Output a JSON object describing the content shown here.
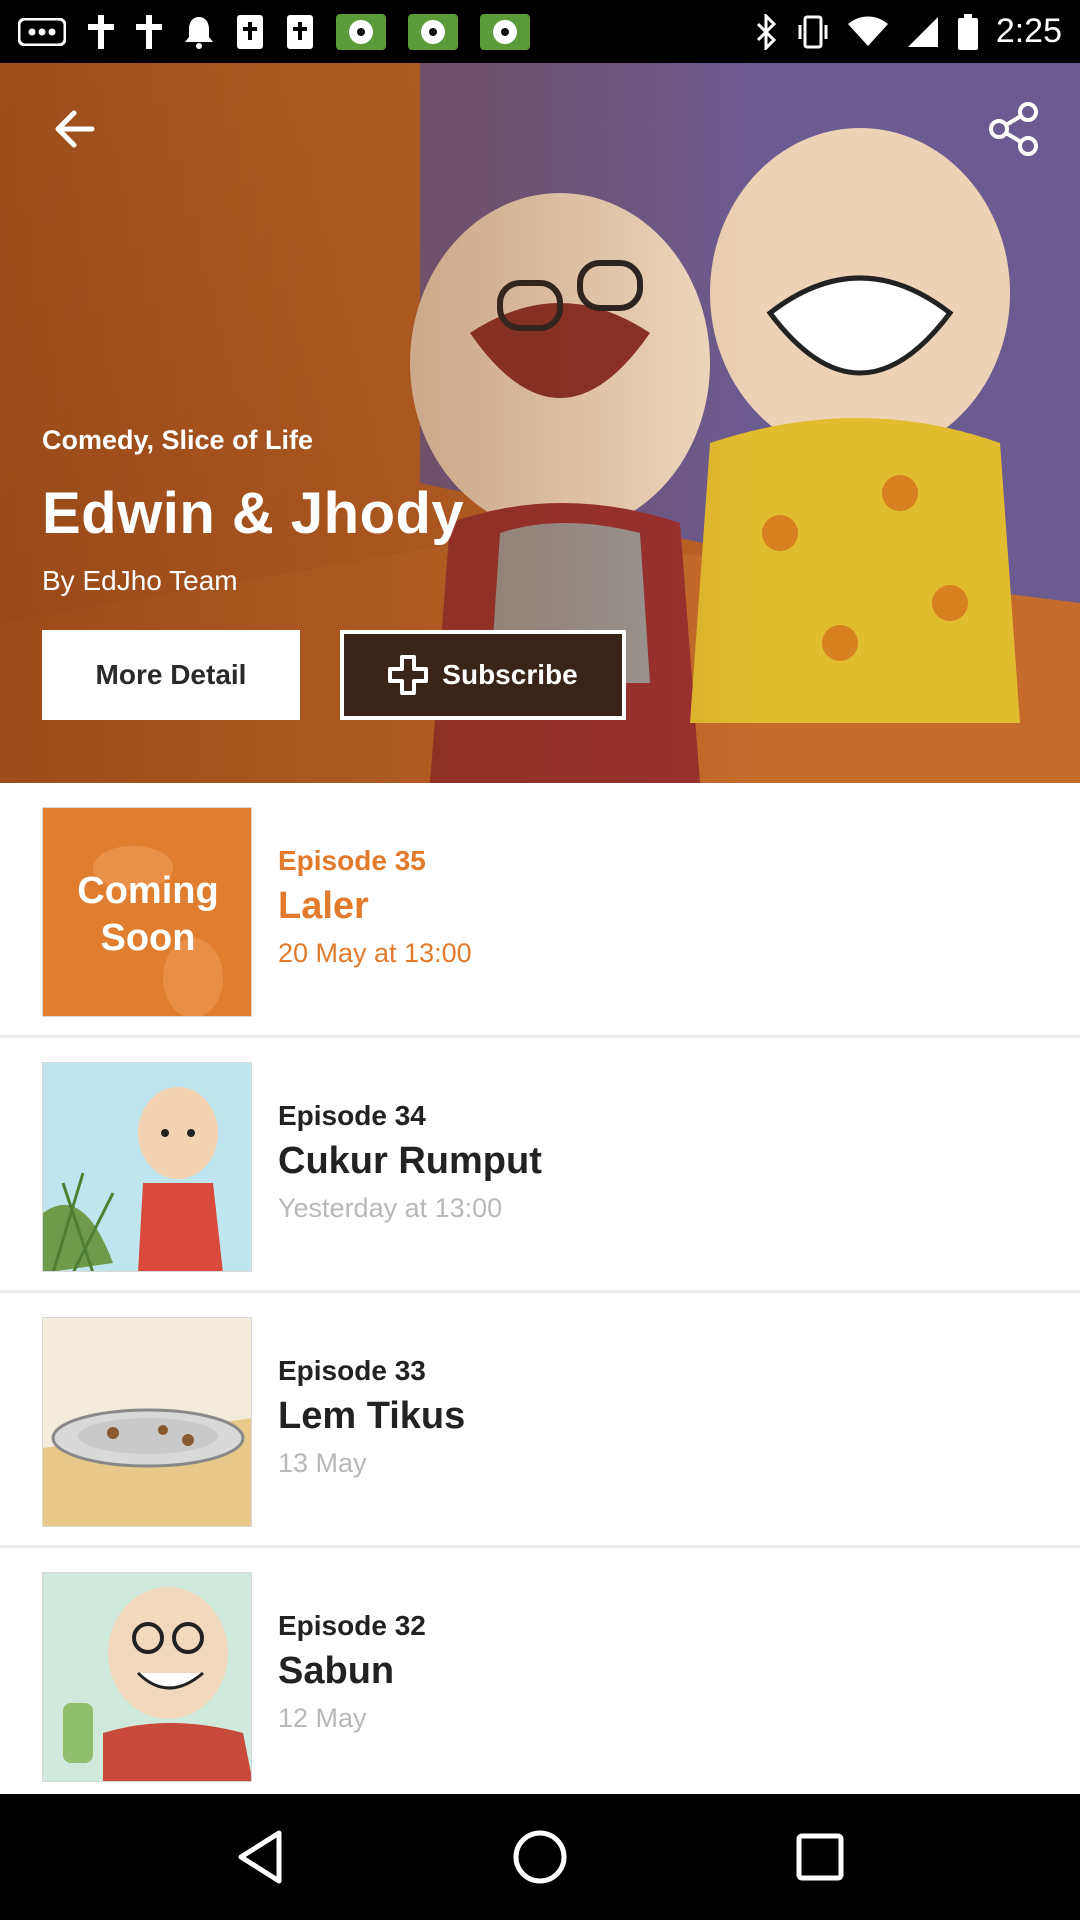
{
  "status_bar": {
    "time": "2:25",
    "left_icons": [
      "more-icon",
      "cross-icon",
      "cross-icon",
      "bell-icon",
      "bible-icon",
      "bible-icon",
      "soccer-icon",
      "soccer-icon",
      "soccer-icon"
    ],
    "right_icons": [
      "bluetooth-icon",
      "vibrate-icon",
      "wifi-icon",
      "signal-icon",
      "battery-icon"
    ]
  },
  "hero": {
    "genre": "Comedy, Slice of Life",
    "title": "Edwin & Jhody",
    "author": "By EdJho Team",
    "more_detail_label": "More Detail",
    "subscribe_label": "Subscribe",
    "colors": {
      "orange": "#c4692b",
      "purple": "#6b5a8e",
      "subscribe_bg": "#3a2318"
    }
  },
  "episodes": [
    {
      "number": "Episode 35",
      "title": "Laler",
      "date": "20 May at 13:00",
      "thumb_text_1": "Coming",
      "thumb_text_2": "Soon",
      "coming_soon": true
    },
    {
      "number": "Episode 34",
      "title": "Cukur Rumput",
      "date": "Yesterday at 13:00"
    },
    {
      "number": "Episode 33",
      "title": "Lem Tikus",
      "date": "13 May"
    },
    {
      "number": "Episode 32",
      "title": "Sabun",
      "date": "12 May"
    }
  ],
  "accent_color": "#e27a2c"
}
